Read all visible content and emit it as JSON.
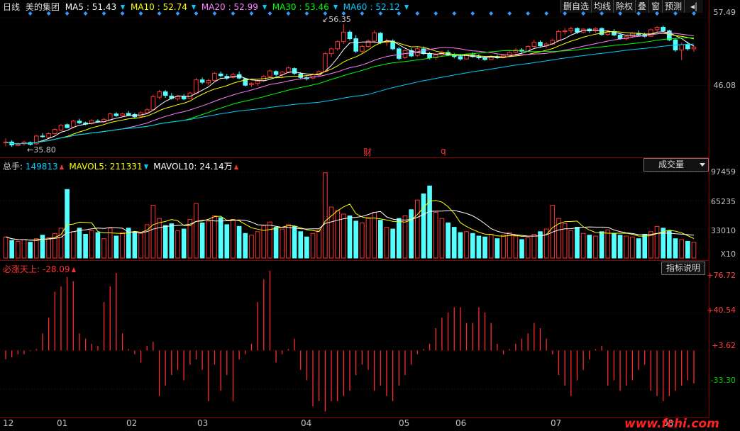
{
  "header": {
    "period": "日线",
    "stock_name": "美的集团",
    "ma": [
      {
        "label": "MA5",
        "value": "51.43",
        "color": "#ffffff",
        "trend": "down"
      },
      {
        "label": "MA10",
        "value": "52.74",
        "color": "#ffff00",
        "trend": "down"
      },
      {
        "label": "MA20",
        "value": "52.99",
        "color": "#ff80ff",
        "trend": "down"
      },
      {
        "label": "MA30",
        "value": "53.46",
        "color": "#00ff00",
        "trend": "down"
      },
      {
        "label": "MA60",
        "value": "52.12",
        "color": "#00ccff",
        "trend": "down"
      }
    ],
    "toolbar": [
      "删自选",
      "均线",
      "除权",
      "叠",
      "窗",
      "预测",
      "◂|"
    ],
    "high_label": "56.35",
    "low_label": "35.80",
    "event_labels": [
      "财",
      "q"
    ]
  },
  "price_axis": [
    "57.49",
    "46.08"
  ],
  "volume": {
    "legend": [
      {
        "label": "总手:",
        "value": "149813",
        "color": "#00ccff",
        "trend": "up"
      },
      {
        "label": "MAVOL5:",
        "value": "211331",
        "color": "#ffff00",
        "trend": "down"
      },
      {
        "label": "MAVOL10:",
        "value": "24.14万",
        "color": "#ffffff",
        "trend": "up"
      }
    ],
    "selector": "成交量",
    "axis": [
      "97459",
      "65235",
      "33010",
      "X10"
    ]
  },
  "indicator": {
    "legend": {
      "label": "必涨天上:",
      "value": "-28.09",
      "trend": "up"
    },
    "button": "指标说明",
    "axis": [
      "+76.72",
      "+40.54",
      "+3.62",
      "-33.30"
    ]
  },
  "x_axis": [
    "12",
    "01",
    "02",
    "03",
    "04",
    "05",
    "06",
    "07",
    "08"
  ],
  "watermark": "www.fchi.com",
  "colors": {
    "up": "#ff3232",
    "down": "#54ffff",
    "frame": "#8a0000",
    "diamond": "#3399ff"
  },
  "chart_data": {
    "type": "candlestick",
    "price_range": [
      34.5,
      58.0
    ],
    "volume_range": [
      0,
      100000
    ],
    "indicator_range": [
      -60,
      80
    ],
    "ohlc": [
      [
        36.5,
        37.2,
        35.9,
        36.6
      ],
      [
        36.6,
        36.9,
        35.8,
        36.1
      ],
      [
        36.0,
        36.5,
        35.9,
        36.2
      ],
      [
        36.3,
        36.8,
        36.0,
        36.6
      ],
      [
        36.5,
        36.7,
        36.0,
        36.2
      ],
      [
        36.3,
        37.8,
        36.1,
        37.6
      ],
      [
        37.6,
        38.1,
        37.3,
        37.5
      ],
      [
        37.4,
        38.2,
        37.2,
        38.0
      ],
      [
        38.0,
        38.9,
        37.8,
        38.7
      ],
      [
        38.6,
        39.6,
        38.4,
        39.4
      ],
      [
        39.5,
        39.7,
        38.9,
        39.0
      ],
      [
        39.1,
        40.3,
        38.9,
        40.1
      ],
      [
        40.1,
        40.5,
        39.6,
        39.8
      ],
      [
        39.8,
        40.0,
        39.4,
        39.6
      ],
      [
        39.7,
        40.4,
        39.5,
        40.2
      ],
      [
        40.1,
        40.4,
        39.8,
        40.0
      ],
      [
        40.0,
        40.6,
        39.8,
        40.4
      ],
      [
        40.3,
        41.5,
        40.2,
        41.3
      ],
      [
        41.3,
        41.6,
        40.8,
        41.0
      ],
      [
        41.0,
        41.5,
        40.9,
        41.3
      ],
      [
        41.4,
        41.8,
        41.0,
        41.1
      ],
      [
        41.2,
        41.5,
        40.6,
        40.8
      ],
      [
        40.9,
        41.7,
        40.8,
        41.5
      ],
      [
        41.5,
        42.2,
        41.3,
        42.0
      ],
      [
        42.0,
        44.5,
        41.9,
        44.2
      ],
      [
        44.1,
        45.3,
        43.8,
        45.0
      ],
      [
        45.0,
        45.3,
        44.0,
        44.4
      ],
      [
        44.3,
        44.8,
        43.7,
        43.9
      ],
      [
        43.8,
        44.4,
        43.5,
        44.2
      ],
      [
        44.2,
        44.6,
        43.6,
        43.8
      ],
      [
        43.9,
        45.0,
        43.8,
        44.8
      ],
      [
        44.8,
        47.3,
        44.6,
        47.0
      ],
      [
        47.0,
        47.4,
        46.3,
        46.6
      ],
      [
        46.5,
        47.2,
        46.1,
        46.9
      ],
      [
        46.9,
        48.3,
        46.8,
        48.1
      ],
      [
        48.0,
        48.4,
        47.4,
        47.7
      ],
      [
        47.6,
        48.0,
        47.0,
        47.3
      ],
      [
        47.4,
        48.2,
        47.2,
        47.9
      ],
      [
        47.9,
        48.4,
        47.1,
        47.3
      ],
      [
        47.2,
        47.3,
        45.9,
        46.1
      ],
      [
        46.2,
        46.6,
        45.8,
        46.4
      ],
      [
        46.4,
        47.0,
        46.0,
        46.8
      ],
      [
        46.9,
        47.8,
        46.7,
        47.6
      ],
      [
        47.6,
        48.7,
        47.4,
        48.5
      ],
      [
        48.4,
        48.6,
        47.6,
        47.9
      ],
      [
        47.9,
        48.5,
        47.3,
        48.3
      ],
      [
        48.3,
        49.2,
        48.1,
        49.0
      ],
      [
        48.9,
        49.1,
        47.8,
        48.1
      ],
      [
        48.0,
        48.3,
        47.2,
        47.4
      ],
      [
        47.4,
        47.6,
        46.9,
        47.2
      ],
      [
        47.3,
        48.1,
        47.1,
        47.9
      ],
      [
        47.8,
        48.6,
        47.6,
        48.4
      ],
      [
        48.4,
        51.6,
        48.3,
        51.4
      ],
      [
        51.4,
        52.4,
        50.8,
        52.2
      ],
      [
        52.2,
        53.6,
        51.9,
        53.4
      ],
      [
        53.4,
        56.35,
        53.0,
        55.0
      ],
      [
        55.0,
        55.3,
        53.6,
        53.9
      ],
      [
        53.9,
        54.5,
        51.5,
        51.8
      ],
      [
        51.8,
        52.9,
        51.5,
        52.6
      ],
      [
        52.6,
        53.8,
        52.4,
        53.5
      ],
      [
        53.5,
        55.3,
        53.2,
        54.9
      ],
      [
        54.8,
        55.0,
        53.0,
        53.3
      ],
      [
        53.3,
        53.9,
        52.7,
        53.5
      ],
      [
        53.5,
        53.8,
        52.0,
        52.2
      ],
      [
        52.2,
        52.5,
        50.3,
        50.6
      ],
      [
        50.7,
        52.1,
        50.5,
        51.9
      ],
      [
        51.9,
        52.3,
        50.8,
        51.0
      ],
      [
        51.1,
        52.5,
        50.8,
        52.2
      ],
      [
        52.2,
        52.6,
        51.2,
        51.4
      ],
      [
        51.4,
        51.7,
        50.4,
        50.7
      ],
      [
        50.7,
        51.5,
        50.3,
        51.2
      ],
      [
        51.2,
        51.9,
        50.9,
        51.6
      ],
      [
        51.6,
        52.0,
        51.0,
        51.2
      ],
      [
        51.2,
        51.5,
        50.6,
        50.9
      ],
      [
        50.9,
        51.3,
        50.2,
        50.5
      ],
      [
        50.5,
        51.4,
        50.4,
        51.2
      ],
      [
        51.2,
        51.6,
        50.7,
        50.9
      ],
      [
        50.9,
        51.3,
        50.4,
        50.7
      ],
      [
        50.7,
        51.0,
        50.2,
        50.4
      ],
      [
        50.4,
        51.1,
        50.3,
        50.9
      ],
      [
        50.9,
        51.2,
        50.5,
        50.7
      ],
      [
        50.7,
        51.3,
        50.6,
        51.1
      ],
      [
        51.1,
        51.8,
        50.9,
        51.6
      ],
      [
        51.6,
        52.3,
        51.4,
        52.0
      ],
      [
        52.0,
        52.3,
        51.5,
        51.8
      ],
      [
        51.8,
        52.8,
        51.7,
        52.6
      ],
      [
        52.6,
        53.7,
        52.4,
        53.3
      ],
      [
        53.3,
        53.6,
        52.4,
        52.7
      ],
      [
        52.7,
        53.3,
        52.3,
        53.0
      ],
      [
        53.0,
        53.9,
        52.8,
        53.6
      ],
      [
        53.6,
        55.4,
        53.4,
        55.1
      ],
      [
        55.1,
        55.7,
        54.6,
        55.2
      ],
      [
        55.2,
        55.9,
        54.8,
        55.6
      ],
      [
        55.6,
        55.8,
        54.7,
        55.0
      ],
      [
        55.0,
        55.7,
        54.8,
        55.5
      ],
      [
        55.5,
        55.7,
        54.9,
        55.2
      ],
      [
        55.2,
        55.8,
        54.9,
        55.6
      ],
      [
        55.6,
        55.8,
        54.4,
        54.6
      ],
      [
        54.6,
        55.3,
        54.4,
        55.0
      ],
      [
        55.0,
        55.5,
        54.3,
        54.5
      ],
      [
        54.5,
        54.8,
        53.7,
        53.9
      ],
      [
        53.9,
        54.5,
        53.6,
        54.3
      ],
      [
        54.3,
        55.0,
        54.0,
        54.8
      ],
      [
        54.8,
        55.3,
        54.4,
        54.6
      ],
      [
        54.6,
        54.9,
        54.1,
        54.3
      ],
      [
        54.3,
        55.6,
        54.2,
        55.4
      ],
      [
        55.4,
        56.0,
        55.0,
        55.8
      ],
      [
        55.8,
        56.1,
        55.0,
        55.2
      ],
      [
        55.2,
        55.4,
        53.5,
        53.7
      ],
      [
        53.7,
        54.0,
        51.7,
        52.0
      ],
      [
        52.0,
        53.2,
        50.3,
        52.9
      ],
      [
        52.9,
        53.4,
        51.9,
        52.2
      ],
      [
        52.2,
        52.7,
        51.7,
        52.5
      ]
    ],
    "volume": [
      24000,
      20000,
      19000,
      21000,
      18000,
      22000,
      26000,
      23000,
      28000,
      34000,
      78000,
      30000,
      34000,
      27000,
      31000,
      29000,
      22000,
      34000,
      25000,
      29000,
      34000,
      30000,
      28000,
      38000,
      60000,
      45000,
      37000,
      39000,
      31000,
      33000,
      44000,
      62000,
      40000,
      42000,
      48000,
      46000,
      38000,
      44000,
      36000,
      28000,
      26000,
      30000,
      37000,
      41000,
      35000,
      33000,
      38000,
      36000,
      30000,
      24000,
      28000,
      32000,
      97000,
      58000,
      54000,
      50000,
      48000,
      42000,
      40000,
      46000,
      52000,
      43000,
      35000,
      33000,
      45000,
      48000,
      55000,
      66000,
      73000,
      82000,
      52000,
      45000,
      40000,
      35000,
      29000,
      30000,
      28000,
      25000,
      24000,
      27000,
      22000,
      26000,
      29000,
      25000,
      21000,
      23000,
      27000,
      30000,
      33000,
      60000,
      45000,
      39000,
      31000,
      35000,
      28000,
      26000,
      25000,
      30000,
      32000,
      28000,
      26000,
      25000,
      24000,
      22000,
      27000,
      30000,
      36000,
      34000,
      31000,
      22000,
      21000,
      19000,
      18000
    ],
    "indicator": [
      -5,
      -3,
      0,
      0,
      3,
      5,
      20,
      35,
      60,
      65,
      74,
      70,
      20,
      15,
      10,
      8,
      50,
      65,
      78,
      20,
      5,
      0,
      -8,
      8,
      12,
      -40,
      -30,
      -20,
      -15,
      -25,
      -10,
      -5,
      -15,
      -45,
      -10,
      -35,
      -20,
      -45,
      -5,
      0,
      10,
      50,
      72,
      80,
      -8,
      0,
      5,
      15,
      -15,
      -25,
      -50,
      -45,
      -55,
      -45,
      -45,
      -40,
      -35,
      -20,
      -10,
      -15,
      -35,
      -30,
      -40,
      -45,
      -30,
      -20,
      -10,
      0,
      5,
      10,
      25,
      35,
      40,
      45,
      45,
      30,
      30,
      45,
      40,
      30,
      10,
      0,
      5,
      10,
      15,
      20,
      30,
      25,
      15,
      0,
      -20,
      -30,
      -40,
      -25,
      -15,
      -5,
      5,
      8,
      -30,
      -25,
      -35,
      -30,
      -25,
      -15,
      -10,
      -35,
      -40,
      -45,
      -40,
      -35,
      -30,
      -25,
      -28
    ]
  }
}
